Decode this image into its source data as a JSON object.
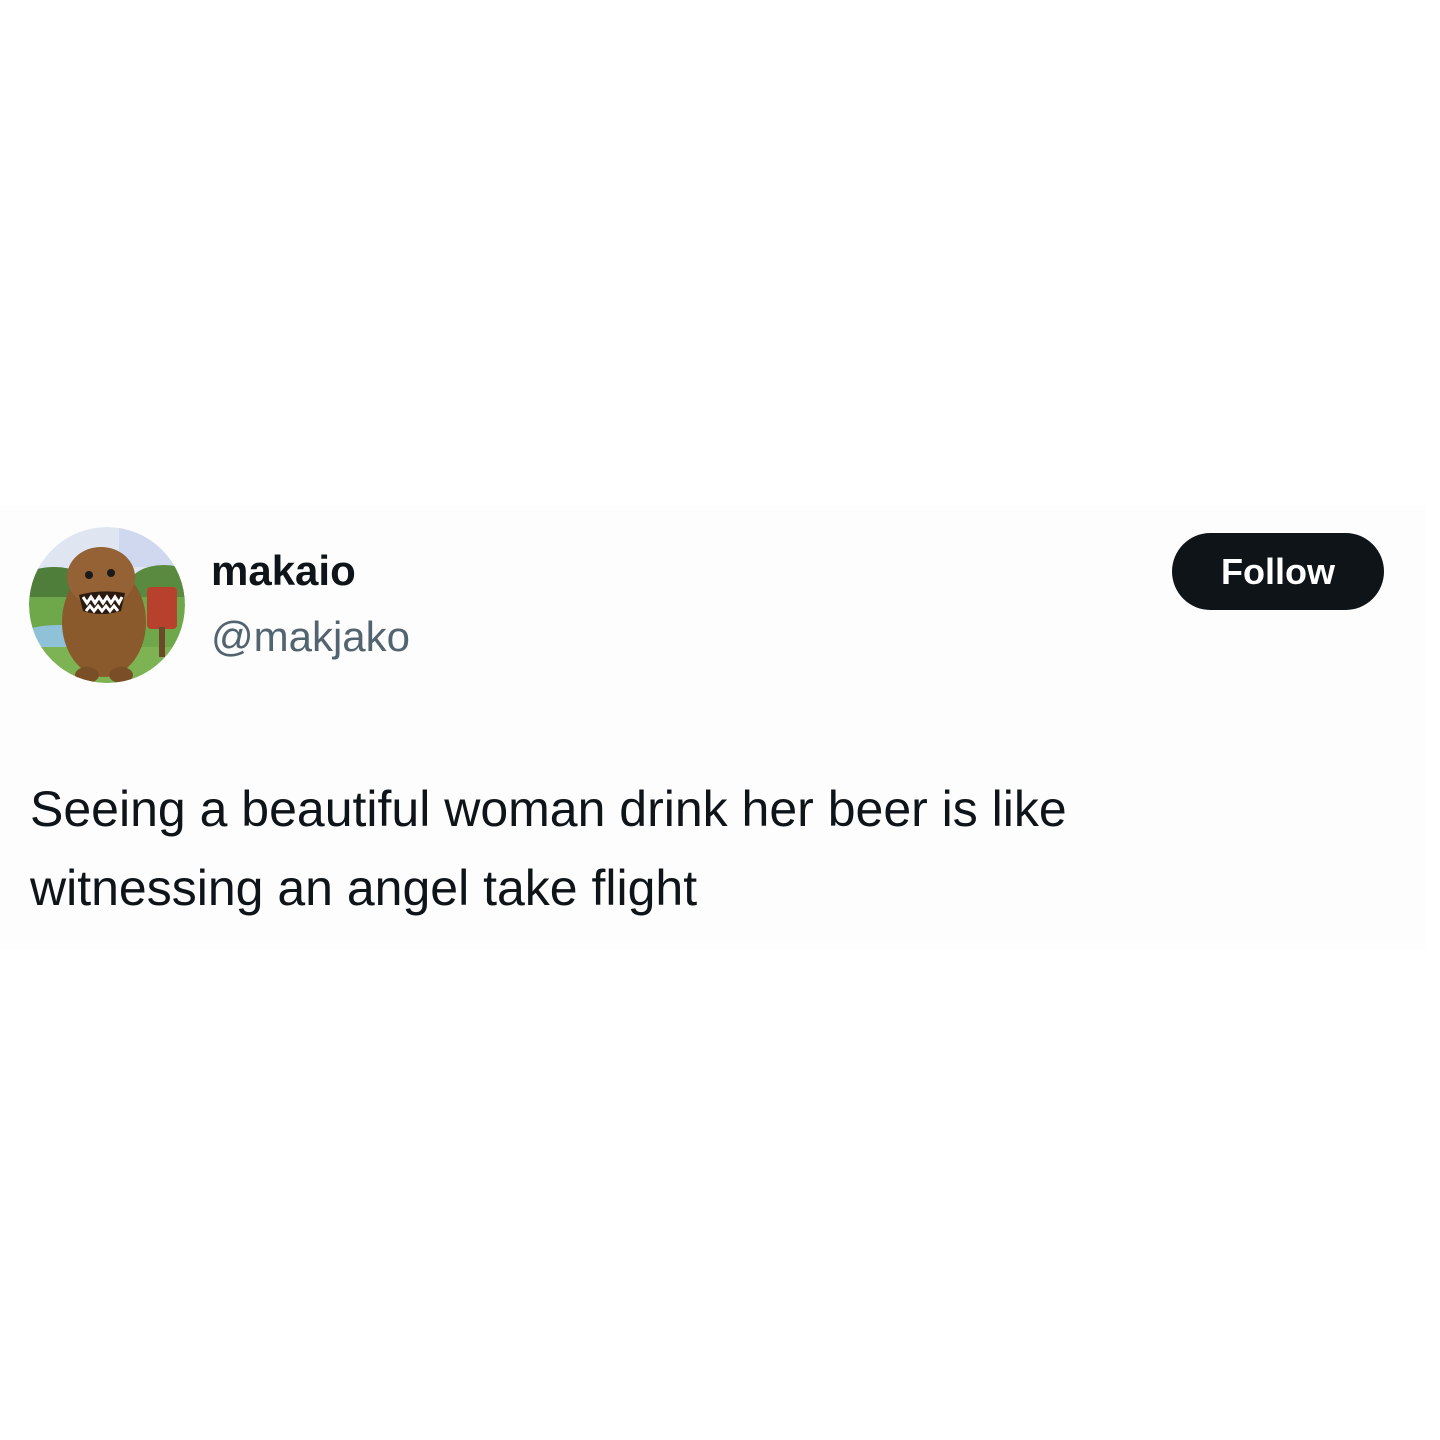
{
  "tweet": {
    "author": {
      "display_name": "makaio",
      "handle": "@makjako",
      "avatar_icon": "domo-character-avatar"
    },
    "follow_label": "Follow",
    "text_lines": [
      "Seeing a beautiful woman drink her beer is like",
      "witnessing an angel take flight"
    ]
  },
  "colors": {
    "text_primary": "#0f1419",
    "text_secondary": "#536471",
    "button_bg": "#0f1419",
    "button_text": "#ffffff"
  }
}
